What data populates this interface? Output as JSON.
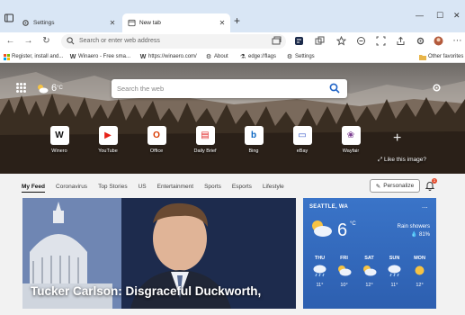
{
  "tabs": [
    {
      "label": "Settings"
    },
    {
      "label": "New tab"
    }
  ],
  "address": {
    "placeholder": "Search or enter web address"
  },
  "favorites": [
    {
      "label": "Register, install and..."
    },
    {
      "label": "Winaero - Free sma..."
    },
    {
      "label": "https://winaero.com/"
    },
    {
      "label": "About"
    },
    {
      "label": "edge://flags"
    },
    {
      "label": "Settings"
    }
  ],
  "other_favorites": "Other favorites",
  "hero": {
    "weather_temp": "6",
    "weather_unit": "°C",
    "search_placeholder": "Search the web",
    "like_text": "Like this image?"
  },
  "quick_links": [
    {
      "label": "Winero",
      "glyph": "W",
      "color": "#111111"
    },
    {
      "label": "YouTube",
      "glyph": "▶",
      "color": "#e62117"
    },
    {
      "label": "Office",
      "glyph": "O",
      "color": "#d83b01"
    },
    {
      "label": "Daily Brief",
      "glyph": "▤",
      "color": "#e02a2a"
    },
    {
      "label": "Bing",
      "glyph": "b",
      "color": "#0a66c2"
    },
    {
      "label": "eBay",
      "glyph": "▭",
      "color": "#3457c9"
    },
    {
      "label": "Wayfair",
      "glyph": "❀",
      "color": "#7a3b8f"
    }
  ],
  "feed_tabs": [
    "My Feed",
    "Coronavirus",
    "Top Stories",
    "US",
    "Entertainment",
    "Sports",
    "Esports",
    "Lifestyle"
  ],
  "personalize_label": "Personalize",
  "notification_count": "1",
  "news": {
    "headline": "Tucker Carlson: Disgraceful Duckworth,"
  },
  "weather_card": {
    "location": "SEATTLE, WA",
    "more": "...",
    "temp": "6",
    "unit": "°C",
    "condition": "Rain showers",
    "humidity": "81%",
    "forecast": [
      {
        "day": "THU",
        "temp": "11°",
        "icon": "rain"
      },
      {
        "day": "FRI",
        "temp": "10°",
        "icon": "partly"
      },
      {
        "day": "SAT",
        "temp": "12°",
        "icon": "partly"
      },
      {
        "day": "SUN",
        "temp": "11°",
        "icon": "rain"
      },
      {
        "day": "MON",
        "temp": "12°",
        "icon": "sun"
      }
    ]
  }
}
